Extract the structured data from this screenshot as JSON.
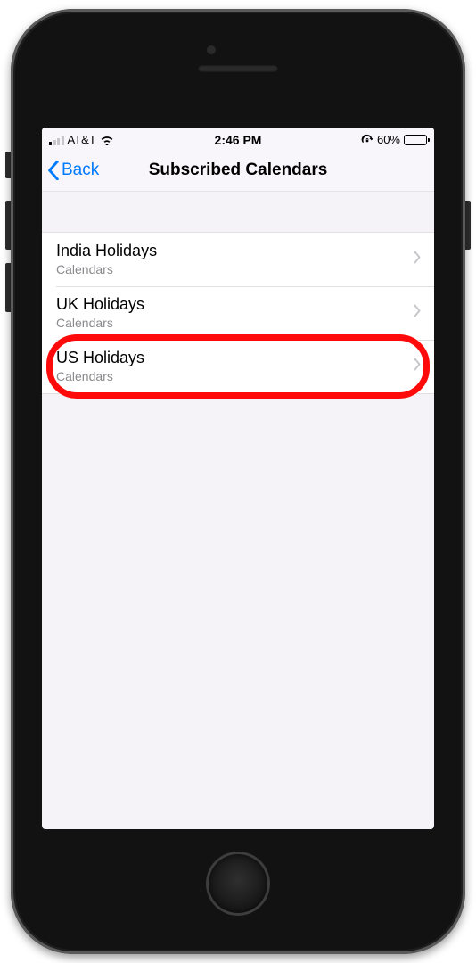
{
  "status": {
    "carrier": "AT&T",
    "time": "2:46 PM",
    "battery_percent": "60%"
  },
  "nav": {
    "back_label": "Back",
    "title": "Subscribed Calendars"
  },
  "list": {
    "items": [
      {
        "title": "India Holidays",
        "subtitle": "Calendars"
      },
      {
        "title": "UK Holidays",
        "subtitle": "Calendars"
      },
      {
        "title": "US Holidays",
        "subtitle": "Calendars"
      }
    ]
  },
  "annotation": {
    "highlighted_index": 2
  }
}
